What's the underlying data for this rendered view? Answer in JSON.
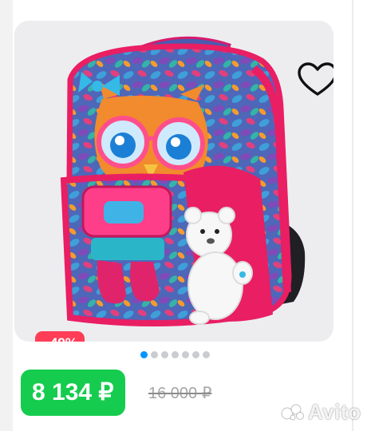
{
  "product": {
    "image_icon": "backpack-product-image",
    "favorite_icon": "heart-outline-icon",
    "discount_badge": "−49%",
    "gallery": {
      "total": 7,
      "active": 0
    },
    "price": "8 134 ₽",
    "old_price": "16 000 ₽"
  },
  "watermark": {
    "text": "Avito"
  },
  "colors": {
    "price_badge": "#16cc4f",
    "discount_badge": "#ff3d57",
    "active_dot": "#0095ff",
    "inactive_dot": "#c9ccd1",
    "card_background": "#ededf0"
  }
}
